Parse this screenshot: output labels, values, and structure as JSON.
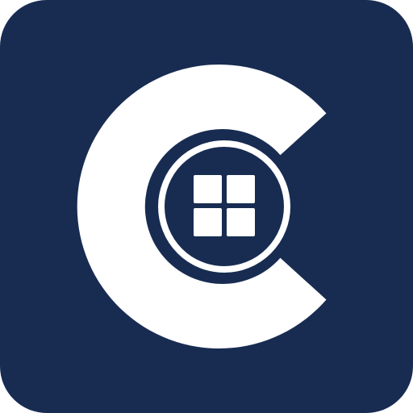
{
  "icon": {
    "name": "c-window-logo-icon",
    "colors": {
      "tile": "#182c52",
      "mark": "#ffffff",
      "page_background": "#ffffff"
    }
  }
}
